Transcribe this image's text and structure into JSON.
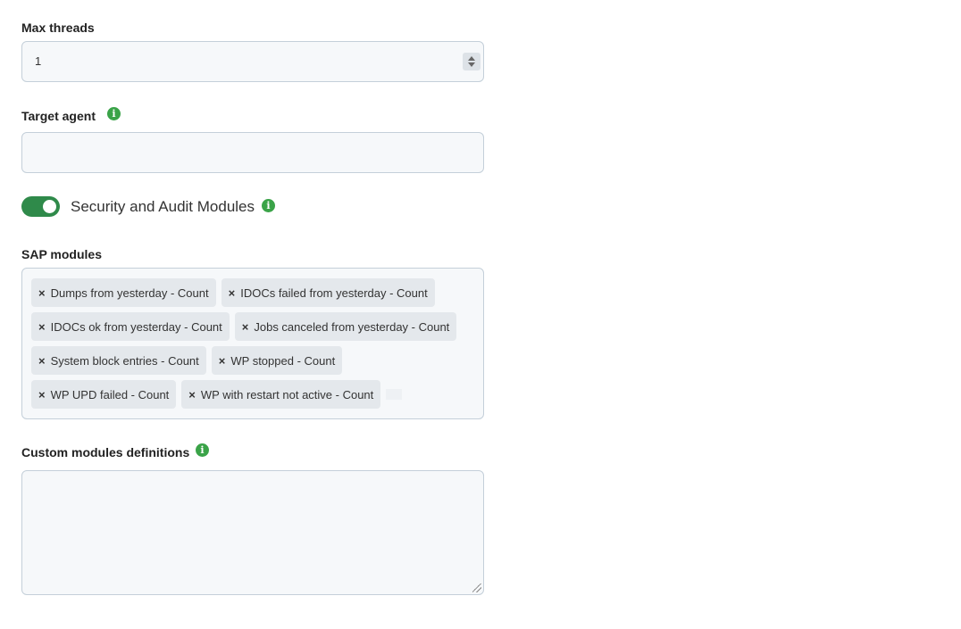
{
  "max_threads": {
    "label": "Max threads",
    "value": "1"
  },
  "target_agent": {
    "label": "Target agent",
    "value": ""
  },
  "security_toggle": {
    "label": "Security and Audit Modules",
    "enabled": true
  },
  "sap_modules": {
    "label": "SAP modules",
    "remove_glyph": "×",
    "chips": [
      "Dumps from yesterday - Count",
      "IDOCs failed from yesterday - Count",
      "IDOCs ok from yesterday - Count",
      "Jobs canceled from yesterday - Count",
      "System block entries - Count",
      "WP stopped - Count",
      "WP UPD failed - Count",
      "WP with restart not active - Count"
    ]
  },
  "custom_modules": {
    "label": "Custom modules definitions",
    "value": ""
  },
  "icons": {
    "info": "info-icon",
    "info_glyph": "i"
  },
  "colors": {
    "accent_green": "#3aa348",
    "toggle_on": "#2f8a4a"
  }
}
